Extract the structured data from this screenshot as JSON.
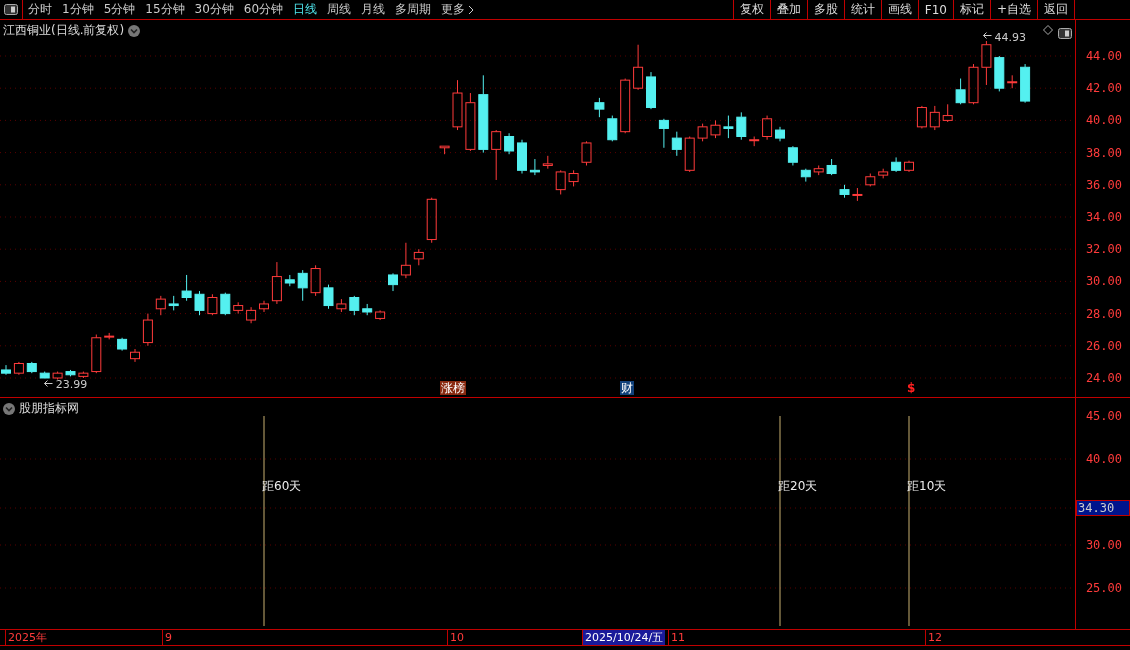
{
  "toolbar": {
    "periods": [
      {
        "label": "分时",
        "selected": false
      },
      {
        "label": "1分钟",
        "selected": false
      },
      {
        "label": "5分钟",
        "selected": false
      },
      {
        "label": "15分钟",
        "selected": false
      },
      {
        "label": "30分钟",
        "selected": false
      },
      {
        "label": "60分钟",
        "selected": false
      },
      {
        "label": "日线",
        "selected": true
      },
      {
        "label": "周线",
        "selected": false
      },
      {
        "label": "月线",
        "selected": false
      },
      {
        "label": "多周期",
        "selected": false
      },
      {
        "label": "更多",
        "selected": false
      }
    ],
    "actions": [
      "复权",
      "叠加",
      "多股",
      "统计",
      "画线",
      "F10",
      "标记",
      "+自选",
      "返回"
    ]
  },
  "main_chart": {
    "title": "江西铜业(日线.前复权)",
    "high_label": "44.93",
    "low_label": "23.99",
    "badges": [
      {
        "text": "涨榜",
        "kind": "rank"
      },
      {
        "text": "财",
        "kind": "finance"
      },
      {
        "text": "$",
        "kind": "signal"
      }
    ],
    "axis": [
      "44.00",
      "42.00",
      "40.00",
      "38.00",
      "36.00",
      "34.00",
      "32.00",
      "30.00",
      "28.00",
      "26.00",
      "24.00"
    ]
  },
  "indicator": {
    "title": "股朋指标网",
    "markers": [
      "距60天",
      "距20天",
      "距10天"
    ],
    "axis": [
      {
        "text": "45.00",
        "kind": "tick"
      },
      {
        "text": "40.00",
        "kind": "tick"
      },
      {
        "text": "34.30",
        "kind": "current"
      },
      {
        "text": "30.00",
        "kind": "tick"
      },
      {
        "text": "25.00",
        "kind": "tick"
      }
    ]
  },
  "date_axis": [
    {
      "text": "2025年",
      "selected": false
    },
    {
      "text": "9",
      "selected": false
    },
    {
      "text": "10",
      "selected": false
    },
    {
      "text": "2025/10/24/五",
      "selected": true
    },
    {
      "text": "11",
      "selected": false
    },
    {
      "text": "12",
      "selected": false
    }
  ]
}
